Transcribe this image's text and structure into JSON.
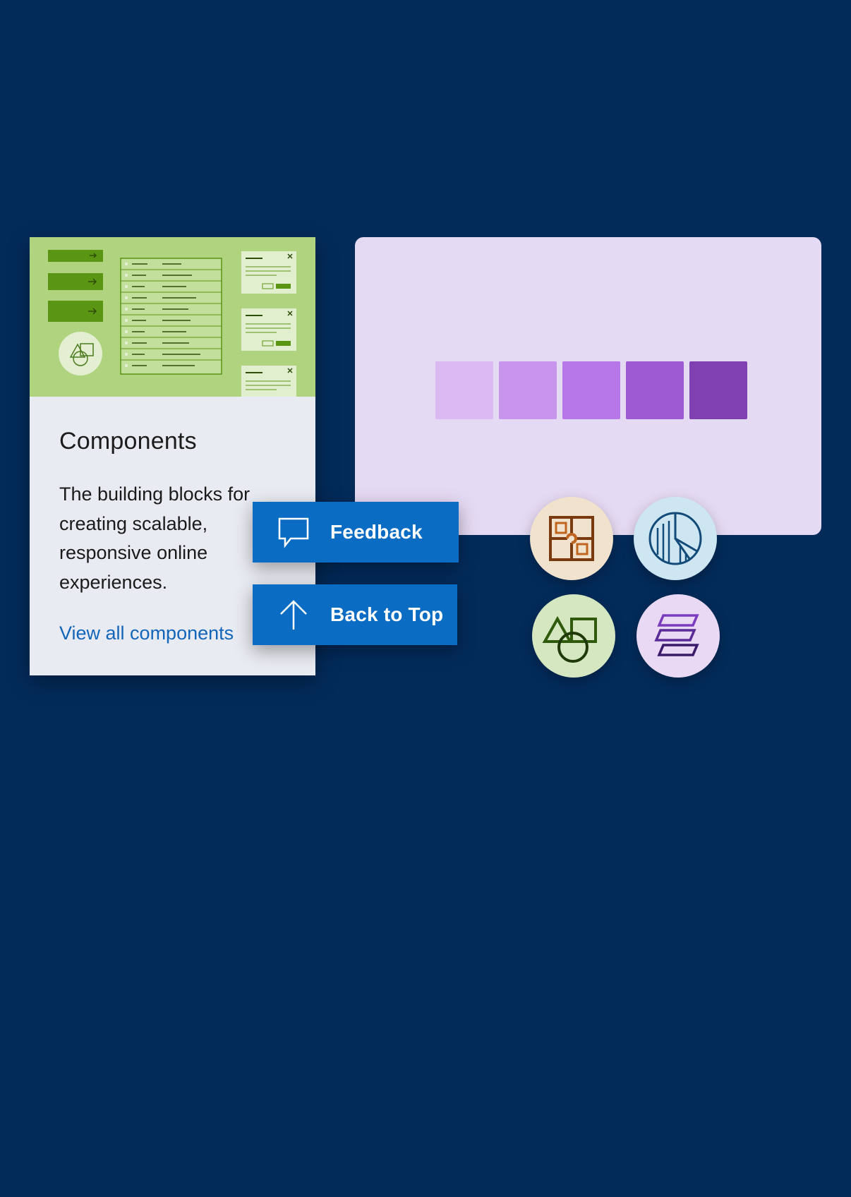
{
  "card": {
    "title": "Components",
    "description": "The building blocks for creating scalable, responsive online experiences.",
    "link_label": "View all components"
  },
  "buttons": {
    "feedback_label": "Feedback",
    "back_to_top_label": "Back to Top"
  },
  "swatches": [
    "#dbb9f2",
    "#c994ee",
    "#b777e8",
    "#9d59d2",
    "#7f41b2"
  ],
  "icons": {
    "puzzle": "puzzle-icon",
    "pie_chart": "pie-chart-icon",
    "shapes": "shapes-icon",
    "layers": "layers-icon"
  },
  "colors": {
    "background": "#032b5a",
    "accent": "#0b6cc4",
    "link": "#1265b8"
  }
}
